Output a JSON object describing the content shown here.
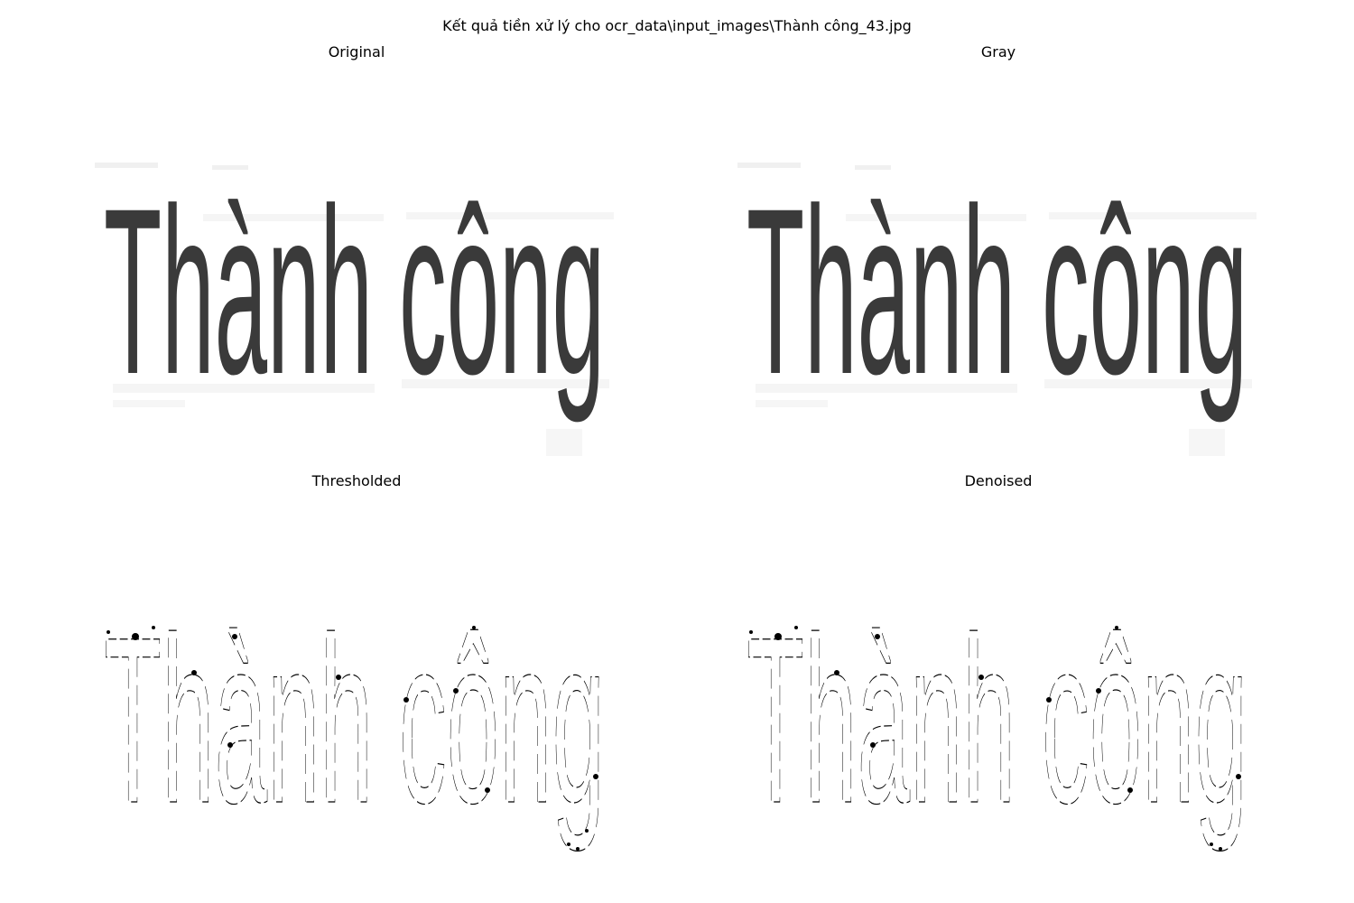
{
  "figure": {
    "suptitle": "Kết quả tiền xử lý cho ocr_data\\input_images\\Thành công_43.jpg"
  },
  "panels": [
    {
      "title": "Original",
      "image_text": "Thành công",
      "style": "gray"
    },
    {
      "title": "Gray",
      "image_text": "Thành công",
      "style": "gray"
    },
    {
      "title": "Thresholded",
      "image_text": "Thành công",
      "style": "binary"
    },
    {
      "title": "Denoised",
      "image_text": "Thành công",
      "style": "binary"
    }
  ],
  "colors": {
    "background": "#ffffff",
    "text": "#000000",
    "gray_stroke": "#3a3a3a",
    "gray_noise": "#d9d9d9"
  }
}
